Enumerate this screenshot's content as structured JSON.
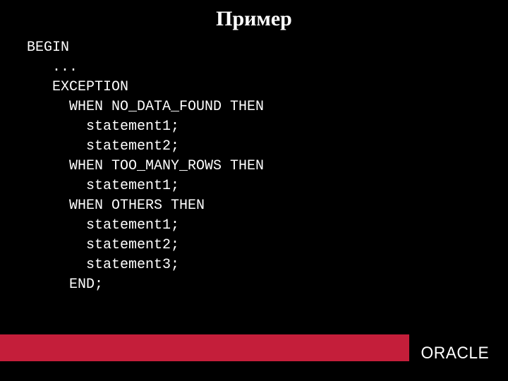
{
  "slide": {
    "title": "Пример",
    "code_lines": {
      "l1": "BEGIN",
      "l2": "   ...",
      "l3": "   EXCEPTION",
      "l4": "     WHEN NO_DATA_FOUND THEN",
      "l5": "       statement1;",
      "l6": "       statement2;",
      "l7": "     WHEN TOO_MANY_ROWS THEN",
      "l8": "       statement1;",
      "l9": "     WHEN OTHERS THEN",
      "l10": "       statement1;",
      "l11": "       statement2;",
      "l12": "       statement3;",
      "l13": "     END;"
    },
    "brand": "ORACLE"
  }
}
